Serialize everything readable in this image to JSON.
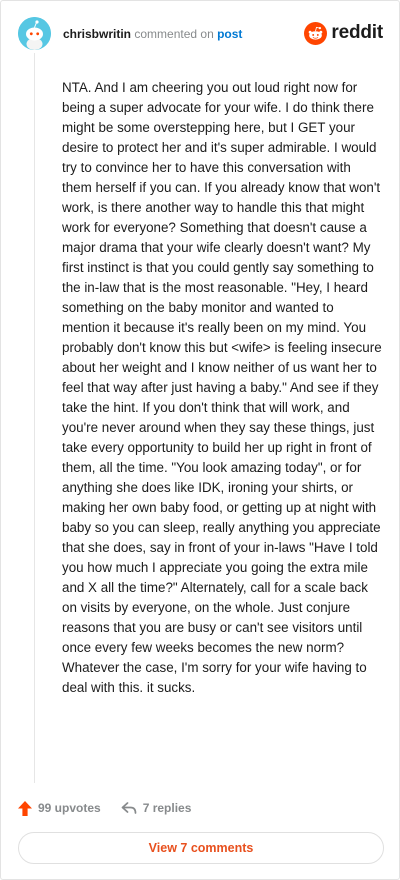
{
  "comment": {
    "username": "chrisbwritin",
    "action_text": "commented on",
    "target_link": "post",
    "body": "NTA. And I am cheering you out loud right now for being a super advocate for your wife. I do think there might be some overstepping here, but I GET your desire to protect her and it's super admirable. I would try to convince her to have this conversation with them herself if you can. If you already know that won't work, is there another way to handle this that might work for everyone? Something that doesn't cause a major drama that your wife clearly doesn't want? My first instinct is that you could gently say something to the in-law that is the most reasonable. \"Hey, I heard something on the baby monitor and wanted to mention it because it's really been on my mind. You probably don't know this but <wife> is feeling insecure about her weight and I know neither of us want her to feel that way after just having a baby.\" And see if they take the hint. If you don't think that will work, and you're never around when they say these things, just take every opportunity to build her up right in front of them, all the time. \"You look amazing today\", or for anything she does like IDK, ironing your shirts, or making her own baby food, or getting up at night with baby so you can sleep, really anything you appreciate that she does, say in front of your in-laws \"Have I told you how much I appreciate you going the extra mile and X all the time?\" Alternately, call for a scale back on visits by everyone, on the whole. Just conjure reasons that you are busy or can't see visitors until once every few weeks becomes the new norm?\nWhatever the case, I'm sorry for your wife having to deal with this. it sucks.",
    "upvotes_label": "99 upvotes",
    "replies_label": "7 replies",
    "view_comments_label": "View 7 comments"
  },
  "brand": {
    "name": "reddit",
    "icon": "reddit-logo-icon",
    "color": "#ff4500"
  },
  "colors": {
    "avatar": "#56c7e3",
    "upvote_arrow": "#ff4500",
    "link": "#0079d3",
    "view_button_text": "#e8501e"
  }
}
